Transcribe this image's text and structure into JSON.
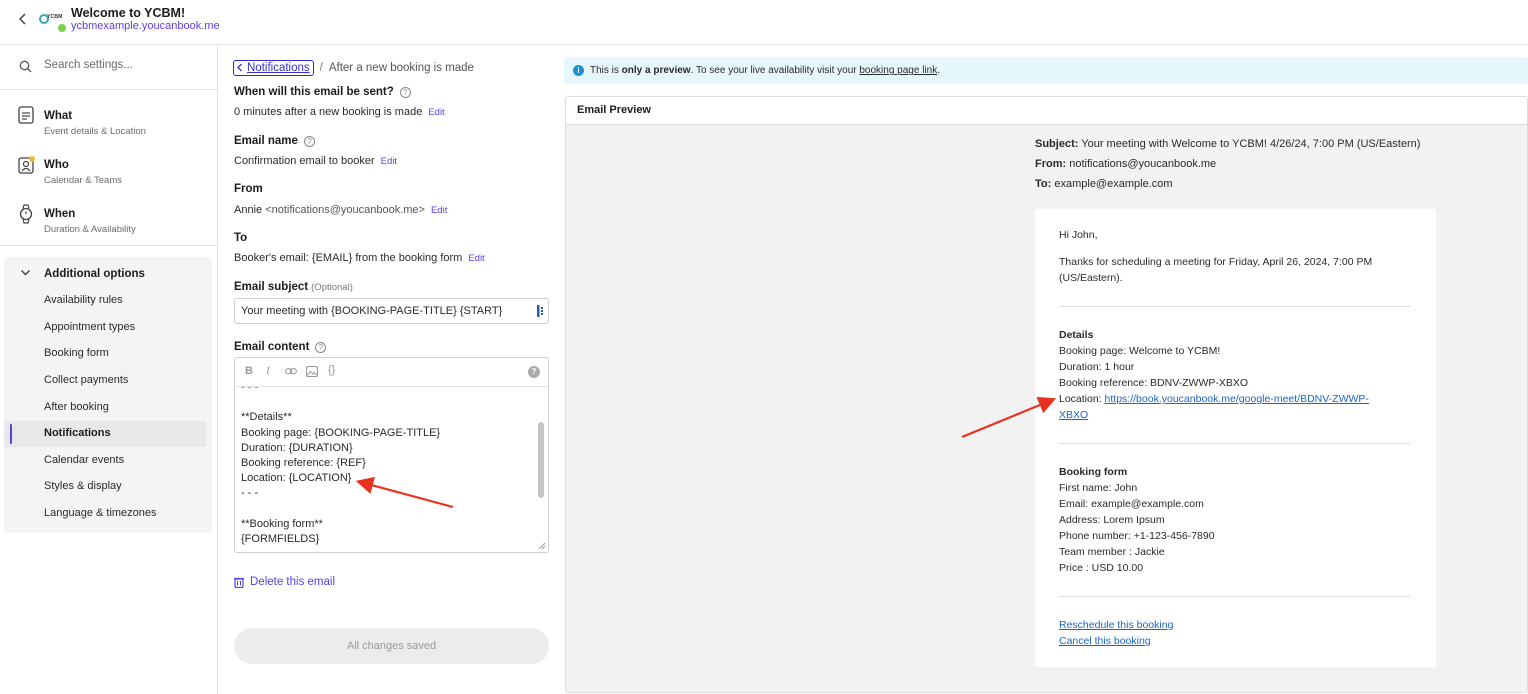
{
  "header": {
    "title": "Welcome to YCBM!",
    "subtitle": "ycbmexample.youcanbook.me",
    "logo_text": "YCBM"
  },
  "sidebar": {
    "search_placeholder": "Search settings...",
    "main_items": [
      {
        "label": "What",
        "sub": "Event details & Location",
        "icon": "document-icon"
      },
      {
        "label": "Who",
        "sub": "Calendar & Teams",
        "icon": "user-badge-icon"
      },
      {
        "label": "When",
        "sub": "Duration & Availability",
        "icon": "watch-icon"
      }
    ],
    "additional_options_label": "Additional options",
    "additional_items": [
      "Availability rules",
      "Appointment types",
      "Booking form",
      "Collect payments",
      "After booking",
      "Notifications",
      "Calendar events",
      "Styles & display",
      "Language & timezones"
    ],
    "active_item": "Notifications"
  },
  "editor_panel": {
    "breadcrumb_link": "Notifications",
    "breadcrumb_current": "After a new booking is made",
    "when_label": "When will this email be sent?",
    "when_value": "0 minutes after a new booking is made",
    "email_name_label": "Email name",
    "email_name_value": "Confirmation email to booker",
    "from_label": "From",
    "from_name": "Annie",
    "from_address": "<notifications@youcanbook.me>",
    "to_label": "To",
    "to_value": "Booker's email: {EMAIL} from the booking form",
    "edit_label": "Edit",
    "subject_label": "Email subject",
    "subject_optional": "(Optional)",
    "subject_value": "Your meeting with {BOOKING-PAGE-TITLE} {START}",
    "content_label": "Email content",
    "content_lines": [
      "- - -",
      "",
      "**Details**",
      "Booking page: {BOOKING-PAGE-TITLE}",
      "Duration: {DURATION}",
      "Booking reference: {REF}",
      "Location: {LOCATION}",
      "- - -",
      "",
      "**Booking form**",
      "{FORMFIELDS}"
    ],
    "delete_label": "Delete this email",
    "saved_label": "All changes saved"
  },
  "info_bar": {
    "prefix": "This is ",
    "emphasis": "only a preview",
    "middle": ". To see your live availability visit your ",
    "link": "booking page link",
    "suffix": "."
  },
  "preview": {
    "title": "Email Preview",
    "subject_label": "Subject:",
    "subject_value": "Your meeting with Welcome to YCBM! 4/26/24, 7:00 PM (US/Eastern)",
    "from_label": "From:",
    "from_value": "notifications@youcanbook.me",
    "to_label": "To:",
    "to_value": "example@example.com",
    "greeting": "Hi John,",
    "intro_line1": "Thanks for scheduling a meeting for Friday, April 26, 2024, 7:00 PM",
    "intro_line2": "(US/Eastern).",
    "details_heading": "Details",
    "details_booking_page": "Booking page: Welcome to YCBM!",
    "details_duration": "Duration: 1 hour",
    "details_reference": "Booking reference: BDNV-ZWWP-XBXO",
    "details_location_label": "Location: ",
    "details_location_link1": "https://book.youcanbook.me/google-meet/BDNV-ZWWP-",
    "details_location_link2": "XBXO",
    "form_heading": "Booking form",
    "form_fields": [
      "First name: John",
      "Email: example@example.com",
      "Address: Lorem Ipsum",
      "Phone number: +1-123-456-7890",
      "Team member : Jackie",
      "Price : USD 10.00"
    ],
    "reschedule_link": "Reschedule this booking",
    "cancel_link": "Cancel this booking"
  },
  "colors": {
    "accent": "#5b3ee0",
    "annotation_arrow": "#e8321e",
    "info_bar": "#e6f6fd",
    "link": "#1a66c9"
  }
}
